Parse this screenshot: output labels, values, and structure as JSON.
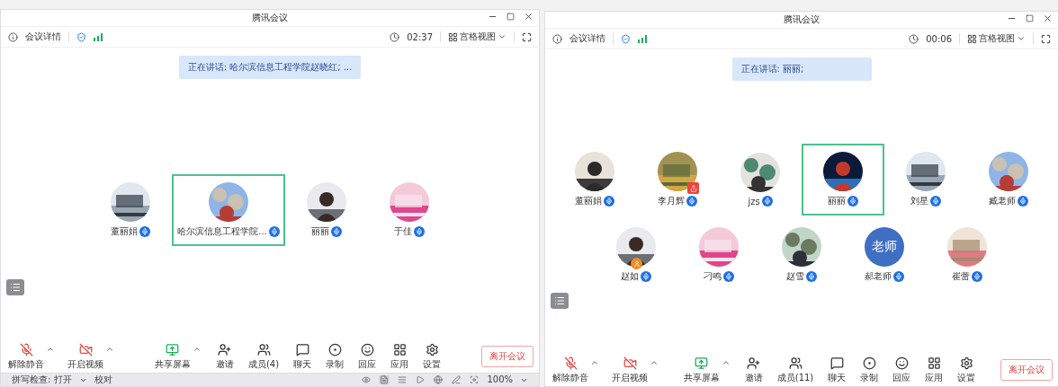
{
  "windows": [
    {
      "title": "腾讯会议",
      "details": "会议详情",
      "timer": "02:37",
      "view": "宫格视图",
      "speaking": "正在讲话: 哈尔滨信息工程学院赵晓红; ...",
      "rows": [
        [
          {
            "name": "董丽娟",
            "kind": "picture",
            "selected": false,
            "host": false,
            "sharing": false
          },
          {
            "name": "哈尔滨信息工程学院...",
            "kind": "picture",
            "selected": true,
            "host": false,
            "sharing": false
          },
          {
            "name": "丽丽",
            "kind": "picture",
            "selected": false,
            "host": false,
            "sharing": false
          },
          {
            "name": "于佳",
            "kind": "picture",
            "selected": false,
            "host": false,
            "sharing": false
          }
        ]
      ],
      "controls": [
        {
          "label": "解除静音",
          "has_menu": true
        },
        {
          "label": "开启视频",
          "has_menu": true
        },
        {
          "label": "共享屏幕",
          "has_menu": true
        },
        {
          "label": "邀请",
          "has_menu": false
        },
        {
          "label": "成员(4)",
          "has_menu": false
        },
        {
          "label": "聊天",
          "has_menu": false
        },
        {
          "label": "录制",
          "has_menu": false
        },
        {
          "label": "回应",
          "has_menu": false
        },
        {
          "label": "应用",
          "has_menu": false
        },
        {
          "label": "设置",
          "has_menu": false
        }
      ],
      "leave": "离开会议",
      "status_bar": {
        "spell": "拼写检查: 打开",
        "proof": "校对",
        "zoom": "100%"
      }
    },
    {
      "title": "腾讯会议",
      "details": "会议详情",
      "timer": "00:06",
      "view": "宫格视图",
      "speaking": "正在讲话: 丽丽;",
      "rows": [
        [
          {
            "name": "董丽娟",
            "kind": "picture",
            "selected": false,
            "host": false,
            "sharing": false
          },
          {
            "name": "李月辉",
            "kind": "picture",
            "selected": false,
            "host": false,
            "sharing": true
          },
          {
            "name": "jzs",
            "kind": "picture",
            "selected": false,
            "host": false,
            "sharing": false
          },
          {
            "name": "丽丽",
            "kind": "picture",
            "selected": true,
            "host": false,
            "sharing": false
          },
          {
            "name": "刘星",
            "kind": "picture",
            "selected": false,
            "host": false,
            "sharing": false
          },
          {
            "name": "臧老师",
            "kind": "picture",
            "selected": false,
            "host": false,
            "sharing": false
          }
        ],
        [
          {
            "name": "赵如",
            "kind": "picture",
            "selected": false,
            "host": true,
            "sharing": false
          },
          {
            "name": "刁鸣",
            "kind": "picture",
            "selected": false,
            "host": false,
            "sharing": false
          },
          {
            "name": "赵雪",
            "kind": "picture",
            "selected": false,
            "host": false,
            "sharing": false
          },
          {
            "name": "郝老师",
            "kind": "text",
            "avatar_text": "老师",
            "selected": false,
            "host": false,
            "sharing": false
          },
          {
            "name": "崔蕾",
            "kind": "picture",
            "selected": false,
            "host": false,
            "sharing": false
          }
        ]
      ],
      "controls": [
        {
          "label": "解除静音",
          "has_menu": true
        },
        {
          "label": "开启视频",
          "has_menu": true
        },
        {
          "label": "共享屏幕",
          "has_menu": true
        },
        {
          "label": "邀请",
          "has_menu": false
        },
        {
          "label": "成员(11)",
          "has_menu": false
        },
        {
          "label": "聊天",
          "has_menu": false
        },
        {
          "label": "录制",
          "has_menu": false
        },
        {
          "label": "回应",
          "has_menu": false
        },
        {
          "label": "应用",
          "has_menu": false
        },
        {
          "label": "设置",
          "has_menu": false
        }
      ],
      "leave": "离开会议"
    }
  ]
}
